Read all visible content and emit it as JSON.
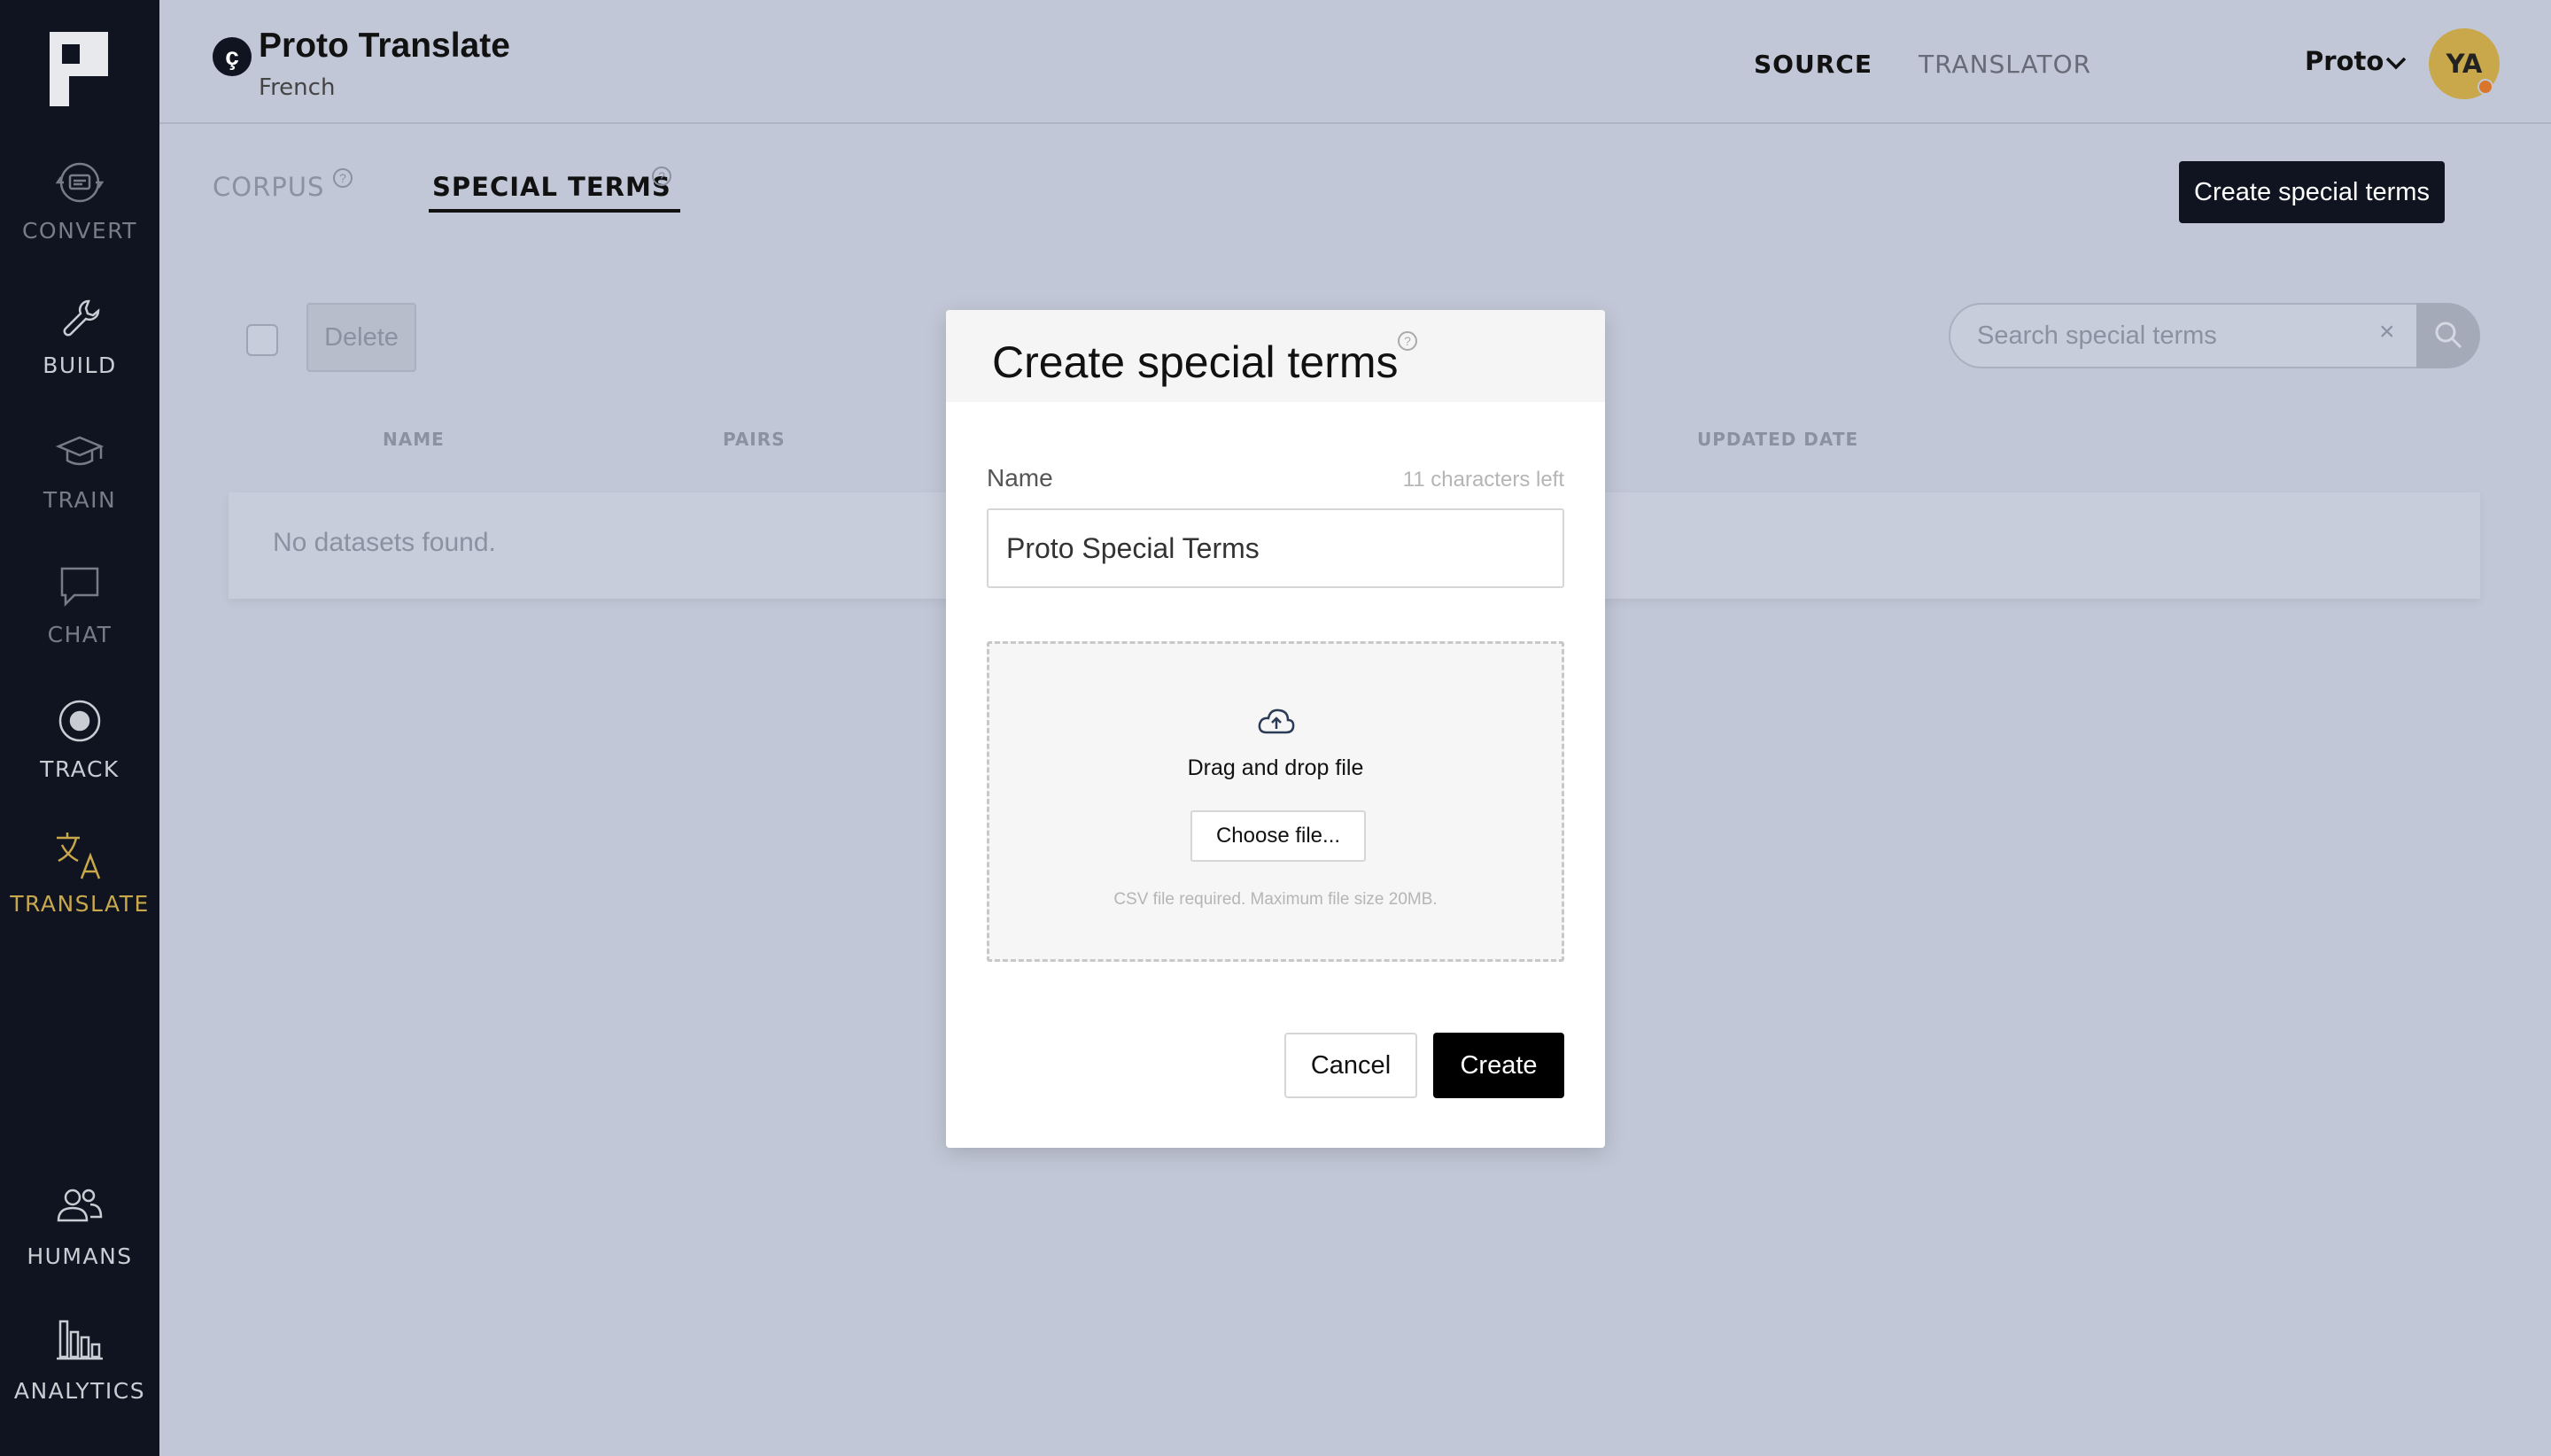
{
  "app": {
    "badge": "ç",
    "title": "Proto Translate",
    "subtitle": "French"
  },
  "sidebar": {
    "items": [
      {
        "label": "CONVERT",
        "icon": "convert-icon"
      },
      {
        "label": "BUILD",
        "icon": "wrench-icon"
      },
      {
        "label": "TRAIN",
        "icon": "graduation-cap-icon"
      },
      {
        "label": "CHAT",
        "icon": "chat-bubble-icon"
      },
      {
        "label": "TRACK",
        "icon": "target-icon"
      },
      {
        "label": "TRANSLATE",
        "icon": "translate-icon"
      },
      {
        "label": "HUMANS",
        "icon": "people-icon"
      },
      {
        "label": "ANALYTICS",
        "icon": "bar-chart-icon"
      }
    ],
    "active": "TRANSLATE"
  },
  "header": {
    "tabs": [
      {
        "label": "SOURCE",
        "active": true
      },
      {
        "label": "TRANSLATOR",
        "active": false
      }
    ],
    "workspace": "Proto",
    "avatar_initials": "YA"
  },
  "subtabs": [
    {
      "label": "CORPUS",
      "active": false
    },
    {
      "label": "SPECIAL TERMS",
      "active": true
    }
  ],
  "help_glyph": "?",
  "toolbar": {
    "create_label": "Create special terms",
    "delete_label": "Delete",
    "search_placeholder": "Search special terms",
    "clear_glyph": "×"
  },
  "table": {
    "columns": [
      "NAME",
      "PAIRS",
      "UPDATED DATE"
    ],
    "empty_message": "No datasets found."
  },
  "modal": {
    "title": "Create special terms",
    "name_label": "Name",
    "chars_left": "11 characters left",
    "name_value": "Proto Special Terms",
    "drop_text": "Drag and drop file",
    "choose_label": "Choose file...",
    "drop_hint": "CSV file required. Maximum file size 20MB.",
    "cancel_label": "Cancel",
    "create_label": "Create"
  },
  "colors": {
    "sidebar_bg": "#0f1420",
    "page_bg": "#c1c7d6",
    "accent_gold": "#c9a74b",
    "status_dot": "#d9762b"
  }
}
